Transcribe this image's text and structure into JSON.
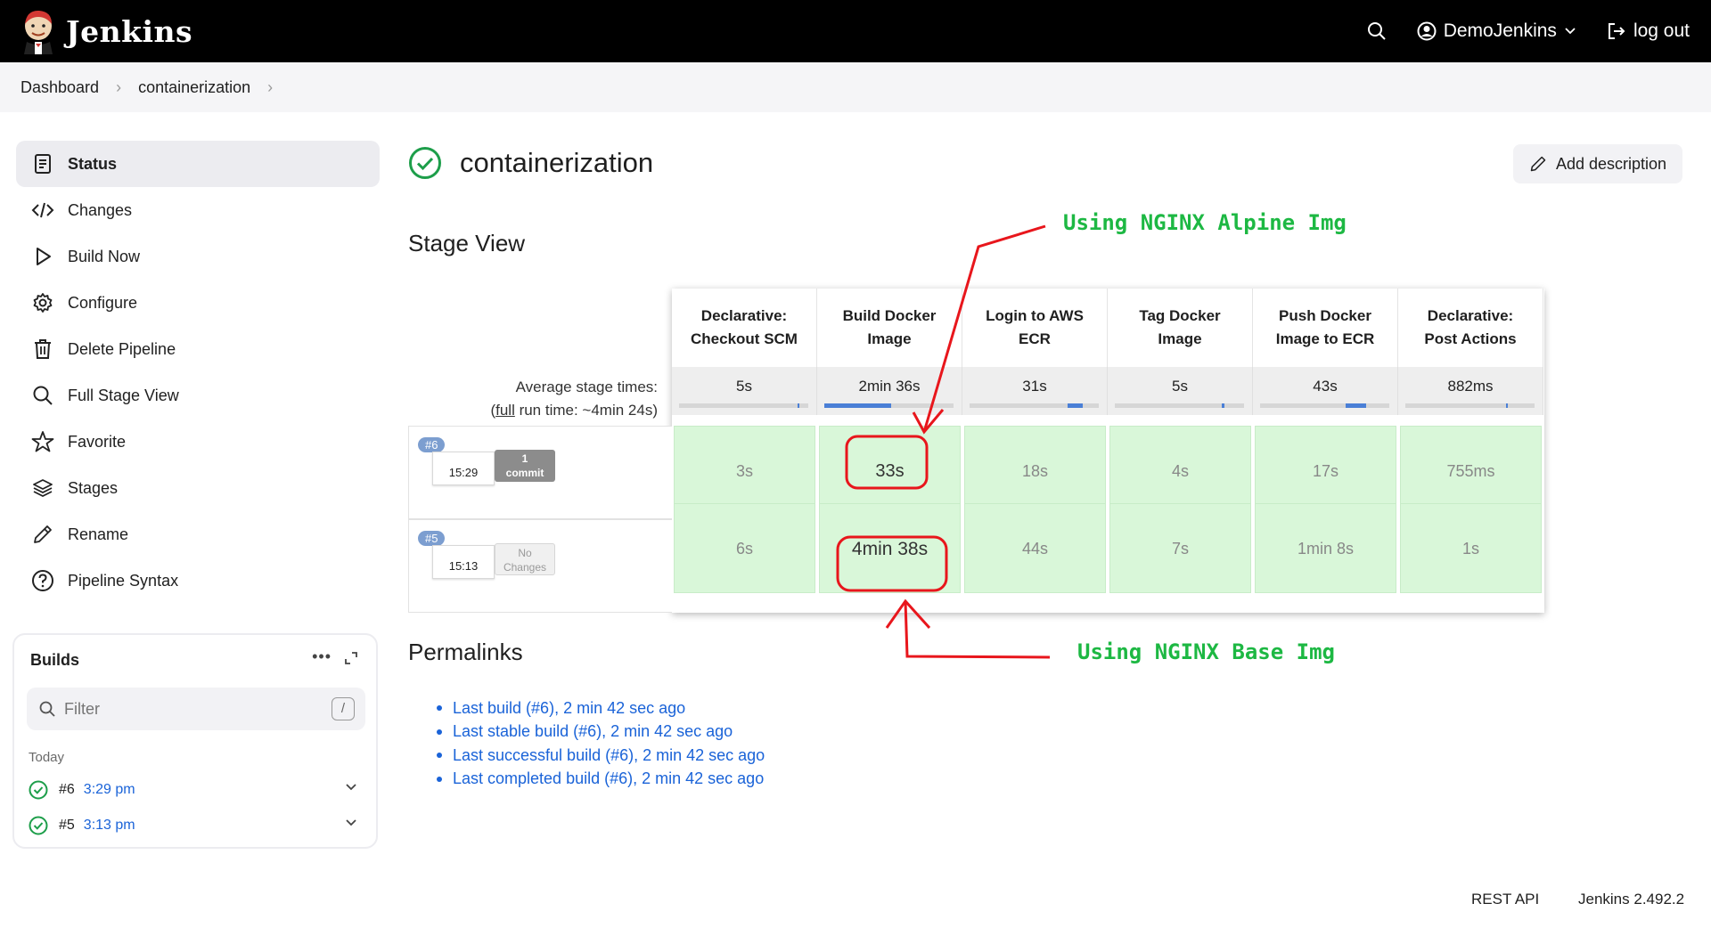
{
  "header": {
    "brand": "Jenkins",
    "user": "DemoJenkins",
    "logout": "log out"
  },
  "breadcrumb": [
    "Dashboard",
    "containerization"
  ],
  "sidebar": {
    "items": [
      {
        "label": "Status",
        "icon": "document-icon",
        "active": true
      },
      {
        "label": "Changes",
        "icon": "code-icon"
      },
      {
        "label": "Build Now",
        "icon": "play-icon"
      },
      {
        "label": "Configure",
        "icon": "gear-icon"
      },
      {
        "label": "Delete Pipeline",
        "icon": "trash-icon"
      },
      {
        "label": "Full Stage View",
        "icon": "search-icon"
      },
      {
        "label": "Favorite",
        "icon": "star-icon"
      },
      {
        "label": "Stages",
        "icon": "layers-icon"
      },
      {
        "label": "Rename",
        "icon": "pencil-icon"
      },
      {
        "label": "Pipeline Syntax",
        "icon": "help-icon"
      }
    ]
  },
  "builds": {
    "title": "Builds",
    "filter_placeholder": "Filter",
    "shortcut": "/",
    "group": "Today",
    "items": [
      {
        "num": "#6",
        "time": "3:29 pm"
      },
      {
        "num": "#5",
        "time": "3:13 pm"
      }
    ]
  },
  "page": {
    "title": "containerization",
    "add_description": "Add description"
  },
  "stage_view": {
    "title": "Stage View",
    "avg_label_line1": "Average stage times:",
    "avg_label_full": "full",
    "avg_label_line2_prefix": "(",
    "avg_label_line2_suffix": " run time: ~4min 24s)",
    "stages": [
      {
        "line1": "Declarative:",
        "line2": "Checkout SCM",
        "avg": "5s"
      },
      {
        "line1": "Build Docker",
        "line2": "Image",
        "avg": "2min 36s"
      },
      {
        "line1": "Login to AWS",
        "line2": "ECR",
        "avg": "31s"
      },
      {
        "line1": "Tag Docker",
        "line2": "Image",
        "avg": "5s"
      },
      {
        "line1": "Push Docker",
        "line2": "Image to ECR",
        "avg": "43s"
      },
      {
        "line1": "Declarative:",
        "line2": "Post Actions",
        "avg": "882ms"
      }
    ],
    "avg_bar_fractions": [
      0.0,
      0.52,
      0.12,
      0.02,
      0.16,
      0.005
    ],
    "runs": [
      {
        "badge": "#6",
        "time": "15:29",
        "changes_line1": "1",
        "changes_line2": "commit",
        "changes_style": "dark",
        "cells": [
          "3s",
          "33s",
          "18s",
          "4s",
          "17s",
          "755ms"
        ]
      },
      {
        "badge": "#5",
        "time": "15:13",
        "changes_line1": "No",
        "changes_line2": "Changes",
        "changes_style": "light",
        "cells": [
          "6s",
          "4min 38s",
          "44s",
          "7s",
          "1min 8s",
          "1s"
        ]
      }
    ]
  },
  "annotations": {
    "top": "Using NGINX Alpine Img",
    "bottom": "Using NGINX Base Img"
  },
  "permalinks": {
    "title": "Permalinks",
    "links": [
      "Last build (#6), 2 min 42 sec ago",
      "Last stable build (#6), 2 min 42 sec ago",
      "Last successful build (#6), 2 min 42 sec ago",
      "Last completed build (#6), 2 min 42 sec ago"
    ]
  },
  "footer": {
    "rest_api": "REST API",
    "version": "Jenkins 2.492.2"
  },
  "colors": {
    "success_cell": "#d9f7d9",
    "success_icon": "#1d9e4a",
    "link": "#1a63d8",
    "annotation_red": "#e8161c",
    "annotation_green": "#1db843"
  }
}
